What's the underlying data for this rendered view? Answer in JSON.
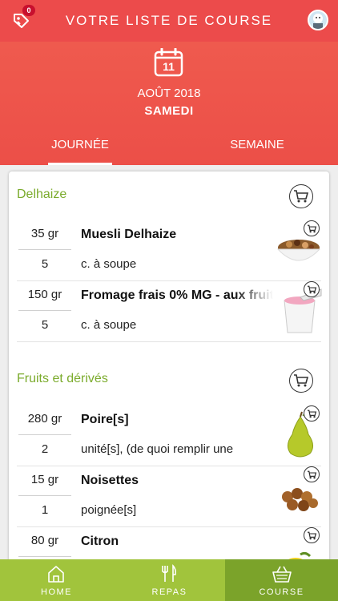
{
  "header": {
    "title": "VOTRE LISTE DE COURSE",
    "badge_count": "0"
  },
  "date": {
    "day_number": "11",
    "month_year": "AOÛT 2018",
    "weekday": "SAMEDI"
  },
  "tabs": [
    {
      "label": "JOURNÉE",
      "active": true
    },
    {
      "label": "SEMAINE",
      "active": false
    }
  ],
  "sections": [
    {
      "title": "Delhaize",
      "items": [
        {
          "qty_weight": "35 gr",
          "qty_count": "5",
          "name": "Muesli Delhaize",
          "unit": "c. à soupe",
          "icon": "muesli-bowl-icon"
        },
        {
          "qty_weight": "150 gr",
          "qty_count": "5",
          "name": "Fromage frais 0% MG - aux fruits",
          "unit": "c. à soupe",
          "icon": "yogurt-cup-icon"
        }
      ]
    },
    {
      "title": "Fruits et dérivés",
      "items": [
        {
          "qty_weight": "280 gr",
          "qty_count": "2",
          "name": "Poire[s]",
          "unit": "unité[s], (de quoi remplir une",
          "icon": "pear-icon"
        },
        {
          "qty_weight": "15 gr",
          "qty_count": "1",
          "name": "Noisettes",
          "unit": "poignée[s]",
          "icon": "hazelnuts-icon"
        },
        {
          "qty_weight": "80 gr",
          "qty_count": "",
          "name": "Citron",
          "unit": "",
          "icon": "lemon-icon"
        }
      ]
    }
  ],
  "bottom_nav": [
    {
      "label": "HOME",
      "icon": "home-icon",
      "active": false
    },
    {
      "label": "REPAS",
      "icon": "fork-knife-icon",
      "active": false
    },
    {
      "label": "COURSE",
      "icon": "basket-icon",
      "active": true
    }
  ],
  "colors": {
    "header_red": "#ec4b4b",
    "section_green": "#7bab2c",
    "nav_green": "#a1c43c",
    "nav_active": "#7ba32a"
  }
}
